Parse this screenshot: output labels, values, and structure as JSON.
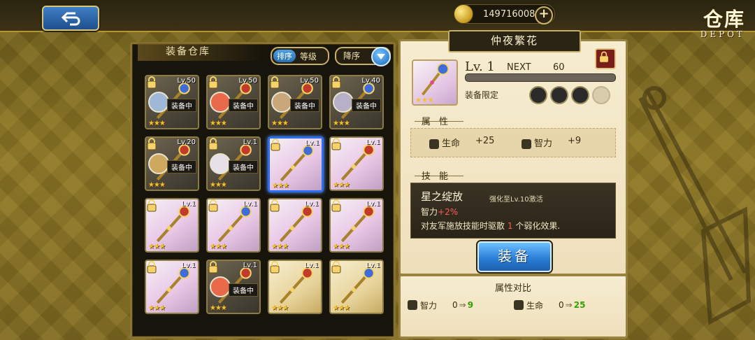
{
  "header": {
    "coins": "149716008",
    "title_cn": "仓库",
    "title_en": "DEPOT"
  },
  "inventory": {
    "title": "装备仓库",
    "sort_key": "排序",
    "sort_value": "等级",
    "order_label": "降序",
    "equipped_tag": "装备中",
    "slots": [
      {
        "level": "Lv.50",
        "state": "equipped",
        "locked": true,
        "stars": "★★★"
      },
      {
        "level": "Lv.50",
        "state": "equipped",
        "locked": true,
        "stars": "★★★"
      },
      {
        "level": "Lv.50",
        "state": "equipped",
        "locked": true,
        "stars": "★★★"
      },
      {
        "level": "Lv.40",
        "state": "equipped",
        "locked": true,
        "stars": "★★★"
      },
      {
        "level": "Lv.20",
        "state": "equipped",
        "locked": true,
        "stars": "★★★"
      },
      {
        "level": "Lv.1",
        "state": "equipped",
        "locked": true,
        "stars": "★★★"
      },
      {
        "level": "Lv.1",
        "state": "selected",
        "locked": true,
        "stars": "★★★"
      },
      {
        "level": "Lv.1",
        "state": "free",
        "locked": true,
        "stars": "★★★"
      },
      {
        "level": "Lv.1",
        "state": "free",
        "locked": true,
        "stars": "★★★"
      },
      {
        "level": "Lv.1",
        "state": "free",
        "locked": true,
        "stars": "★★★"
      },
      {
        "level": "Lv.1",
        "state": "free",
        "locked": true,
        "stars": "★★★"
      },
      {
        "level": "Lv.1",
        "state": "free",
        "locked": true,
        "stars": "★★★"
      },
      {
        "level": "Lv.1",
        "state": "free",
        "locked": true,
        "stars": "★★★"
      },
      {
        "level": "Lv.1",
        "state": "equipped",
        "locked": true,
        "stars": "★★★"
      },
      {
        "level": "Lv.1",
        "state": "gold",
        "locked": true,
        "stars": "★★★"
      },
      {
        "level": "Lv.1",
        "state": "gold",
        "locked": true,
        "stars": "★★★"
      }
    ]
  },
  "detail": {
    "name": "仲夜繁花",
    "level": "Lv. 1",
    "next_label": "NEXT",
    "next_value": "60",
    "exp_fraction": 0.0,
    "restrict_label": "装备限定",
    "stars": "★★★",
    "attr_title": "属 性",
    "stats": [
      {
        "name": "生命",
        "value": "+25"
      },
      {
        "name": "智力",
        "value": "+9"
      }
    ],
    "skill_title": "技 能",
    "skill_name": "星之绽放",
    "skill_unlock": "强化至Lv.10激活",
    "skill_line1_prefix": "智力",
    "skill_line1_value": "+2%",
    "skill_line2_a": "对友军施放技能时驱散",
    "skill_line2_num": "1",
    "skill_line2_b": "个弱化效果.",
    "equip_button": "装备"
  },
  "compare": {
    "title": "属性对比",
    "rows": [
      {
        "name": "智力",
        "old": "0",
        "arrow": "⇒",
        "new": "9"
      },
      {
        "name": "生命",
        "old": "0",
        "arrow": "⇒",
        "new": "25"
      }
    ]
  },
  "colors": {
    "accent_blue": "#2b7fd8",
    "gold_border": "#c7ae68",
    "stat_increase": "#35a000",
    "skill_highlight": "#ff5a5a"
  }
}
